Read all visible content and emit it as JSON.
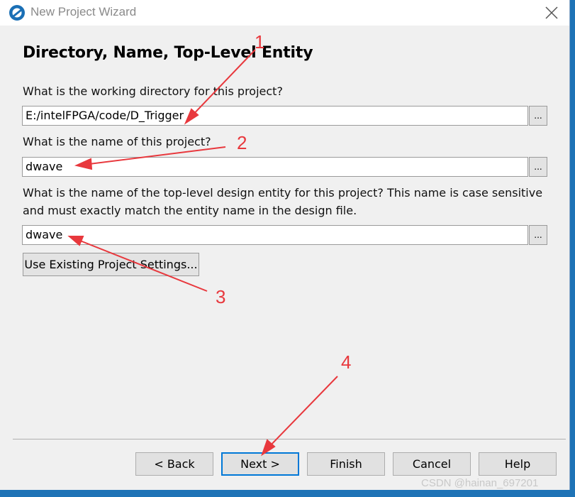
{
  "window": {
    "title": "New Project Wizard",
    "icon": "quartus-logo-icon",
    "close_icon": "close-icon"
  },
  "page": {
    "heading": "Directory, Name, Top-Level Entity"
  },
  "fields": {
    "directory": {
      "label": "What is the working directory for this project?",
      "value": "E:/intelFPGA/code/D_Trigger",
      "browse_label": "..."
    },
    "project_name": {
      "label": "What is the name of this project?",
      "value": "dwave",
      "browse_label": "..."
    },
    "top_level": {
      "label_line1": "What is the name of the top-level design entity for this project? This name is case sensitive",
      "label_line2": "and must exactly match the entity name in the design file.",
      "value": "dwave",
      "browse_label": "..."
    }
  },
  "buttons": {
    "use_existing": "Use Existing Project Settings...",
    "back": "< Back",
    "next": "Next >",
    "finish": "Finish",
    "cancel": "Cancel",
    "help": "Help"
  },
  "annotations": {
    "color": "#e8383d",
    "labels": [
      "1",
      "2",
      "3",
      "4"
    ]
  },
  "watermark": "CSDN @hainan_697201"
}
